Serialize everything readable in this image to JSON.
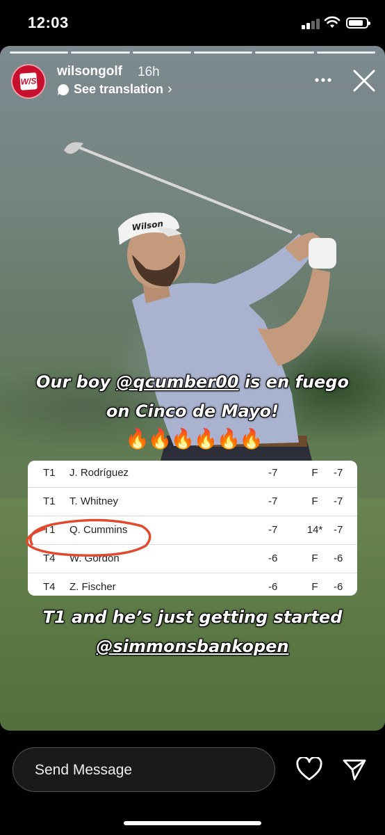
{
  "status": {
    "time": "12:03"
  },
  "story": {
    "segments": 6,
    "account": "wilsongolf",
    "age": "16h",
    "translation": "See translation",
    "avatar_logo": "W/S",
    "caption_top_1_pre": "Our boy ",
    "caption_top_1_mention": "@qcumber00",
    "caption_top_1_post": " is en fuego",
    "caption_top_2": "on Cinco de Mayo!",
    "flames": "🔥🔥🔥🔥🔥🔥",
    "caption_bottom_1": "T1 and he’s just getting started",
    "caption_bottom_2": "@simmonsbankopen",
    "leaderboard": [
      {
        "pos": "T1",
        "name": "J. Rodríguez",
        "today": "-7",
        "thru": "F",
        "total": "-7"
      },
      {
        "pos": "T1",
        "name": "T. Whitney",
        "today": "-7",
        "thru": "F",
        "total": "-7"
      },
      {
        "pos": "T1",
        "name": "Q. Cummins",
        "today": "-7",
        "thru": "14*",
        "total": "-7"
      },
      {
        "pos": "T4",
        "name": "W. Gordon",
        "today": "-6",
        "thru": "F",
        "total": "-6"
      },
      {
        "pos": "T4",
        "name": "Z. Fischer",
        "today": "-6",
        "thru": "F",
        "total": "-6"
      }
    ]
  },
  "composer": {
    "placeholder": "Send Message"
  },
  "colors": {
    "brand_red": "#c8102e",
    "circle_red": "#e04a2e"
  },
  "icons": [
    "signal-icon",
    "wifi-icon",
    "battery-icon",
    "more-icon",
    "close-icon",
    "translate-bubble-icon",
    "heart-icon",
    "send-icon"
  ]
}
